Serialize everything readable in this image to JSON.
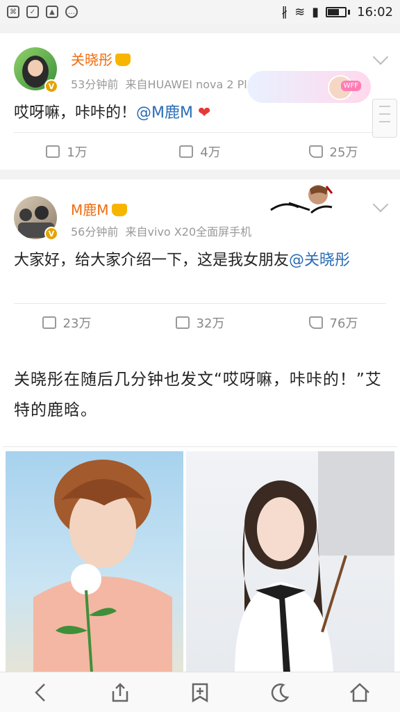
{
  "status_bar": {
    "time": "16:02",
    "left_icons": [
      "notification-icon",
      "shield-icon",
      "image-icon",
      "message-icon"
    ],
    "right_icons": [
      "bluetooth-icon",
      "wifi-icon",
      "signal-icon",
      "battery-icon"
    ]
  },
  "posts": [
    {
      "user": "关晓彤",
      "time": "53分钟前",
      "source": "来自HUAWEI nova 2 Plus",
      "text_main": "哎呀嘛，咔咔的！",
      "mention": "@M鹿M",
      "emoji": "❤",
      "stats": {
        "repost": "1万",
        "comment": "4万",
        "like": "25万"
      },
      "banner_tag": "WFF"
    },
    {
      "user": "M鹿M",
      "time": "56分钟前",
      "source": "来自vivo X20全面屏手机",
      "text_main": "大家好，给大家介绍一下，这是我女朋友",
      "mention": "@关晓彤",
      "stats": {
        "repost": "23万",
        "comment": "32万",
        "like": "76万"
      }
    }
  ],
  "article": {
    "paragraph": "关晓彤在随后几分钟也发文“哎呀嘛，咔咔的！”艾特的鹿晗。"
  },
  "colors": {
    "username": "#f26b0d",
    "mention": "#2a6cb5",
    "meta": "#999999"
  },
  "bottom_nav": [
    "back-icon",
    "share-icon",
    "bookmark-add-icon",
    "night-mode-icon",
    "home-icon"
  ]
}
